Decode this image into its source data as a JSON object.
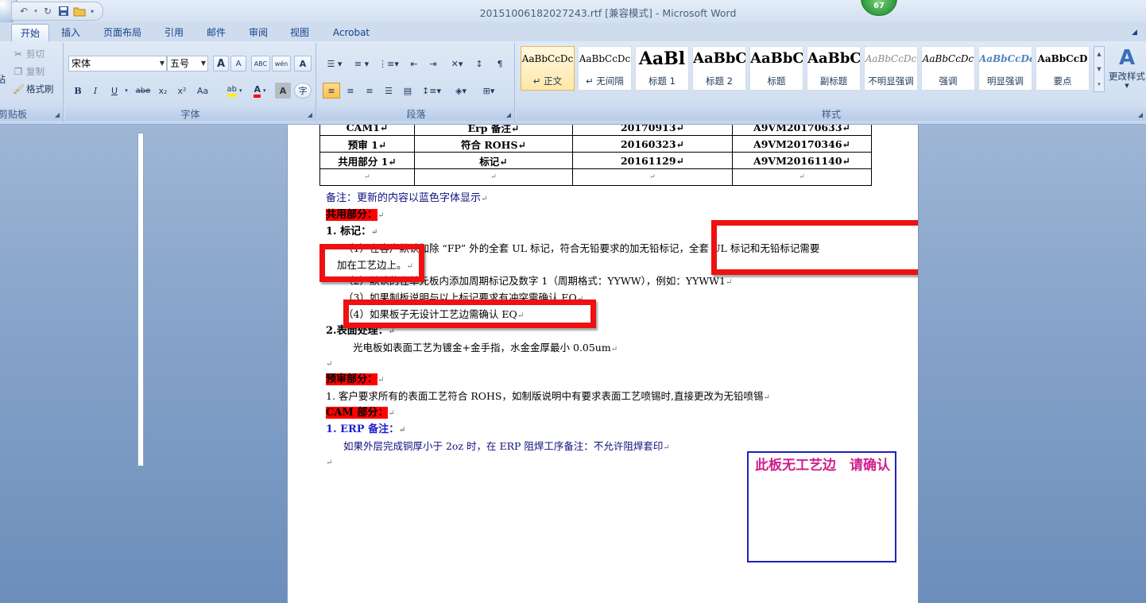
{
  "window": {
    "title": "20151006182027243.rtf [兼容模式] - Microsoft Word",
    "badge_count": "67"
  },
  "tabs": [
    {
      "label": "开始",
      "active": true
    },
    {
      "label": "插入"
    },
    {
      "label": "页面布局"
    },
    {
      "label": "引用"
    },
    {
      "label": "邮件"
    },
    {
      "label": "审阅"
    },
    {
      "label": "视图"
    },
    {
      "label": "Acrobat"
    }
  ],
  "ribbon": {
    "clipboard": {
      "label": "剪贴板",
      "paste": "粘",
      "cut": "剪切",
      "copy": "复制",
      "format_painter": "格式刷"
    },
    "font": {
      "label": "字体",
      "font_name": "宋体",
      "font_size": "五号",
      "bold": "B",
      "italic": "I",
      "underline": "U",
      "strike": "abe",
      "subscript": "x₂",
      "superscript": "x²",
      "change_case": "Aa",
      "grow": "A",
      "shrink": "A",
      "clear": "ABC",
      "phonetic": "wén",
      "border_char": "A",
      "shade_char": "A",
      "enclose": "字"
    },
    "paragraph": {
      "label": "段落"
    },
    "styles": {
      "label": "样式",
      "items": [
        {
          "sample": "AaBbCcDc",
          "name": "↵ 正文",
          "selected": true
        },
        {
          "sample": "AaBbCcDc",
          "name": "↵ 无间隔"
        },
        {
          "sample": "AaBl",
          "name": "标题 1"
        },
        {
          "sample": "AaBbC",
          "name": "标题 2"
        },
        {
          "sample": "AaBbC",
          "name": "标题"
        },
        {
          "sample": "AaBbC",
          "name": "副标题"
        },
        {
          "sample": "AaBbCcDc",
          "name": "不明显强调"
        },
        {
          "sample": "AaBbCcDc",
          "name": "强调"
        },
        {
          "sample": "AaBbCcDc",
          "name": "明显强调"
        },
        {
          "sample": "AaBbCcD",
          "name": "要点"
        }
      ],
      "change_styles": "更改样式"
    }
  },
  "document": {
    "table": {
      "rows": [
        [
          "CAM1↵",
          "Erp 备注↵",
          "20170913↵",
          "A9VM20170633↵"
        ],
        [
          "预审 1↵",
          "符合 ROHS↵",
          "20160323↵",
          "A9VM20170346↵"
        ],
        [
          "共用部分 1↵",
          "标记↵",
          "20161129↵",
          "A9VM20161140↵"
        ],
        [
          "↵",
          "↵",
          "↵",
          "↵"
        ]
      ]
    },
    "note": "备注：更新的内容以蓝色字体显示",
    "shared_heading": "共用部分：",
    "marking_heading": "1. 标记：",
    "item1_line1": "（1）在客户默认加除 “FP” 外的全套 UL 标记，符合无铅要求的加无铅标记，全套 UL 标记和无铅标记需要",
    "item1_line2": "加在工艺边上。",
    "item2": "（2）默认的在单元板内添加周期标记及数字 1（周期格式：YYWW），例如：YYWW1",
    "item3": "（3）如果制板说明与以上标记要求有冲突需确认 EQ",
    "item4": "（4）如果板子无设计工艺边需确认 EQ",
    "surface_heading": "2.表面处理：",
    "surface_text": "光电板如表面工艺为镀金+金手指，水金金厚最小 0.05um",
    "precheck_heading": "预审部分：",
    "precheck_text": "1. 客户要求所有的表面工艺符合 ROHS，如制版说明中有要求表面工艺喷锡时,直接更改为无铅喷锡",
    "cam_heading": "CAM 部分：",
    "erp_heading": "1. ERP 备注：",
    "erp_text": "如果外层完成铜厚小于 2oz 时，在 ERP 阻焊工序备注：不允许阻焊套印",
    "stamp_text": "此板无工艺边　请确认"
  }
}
